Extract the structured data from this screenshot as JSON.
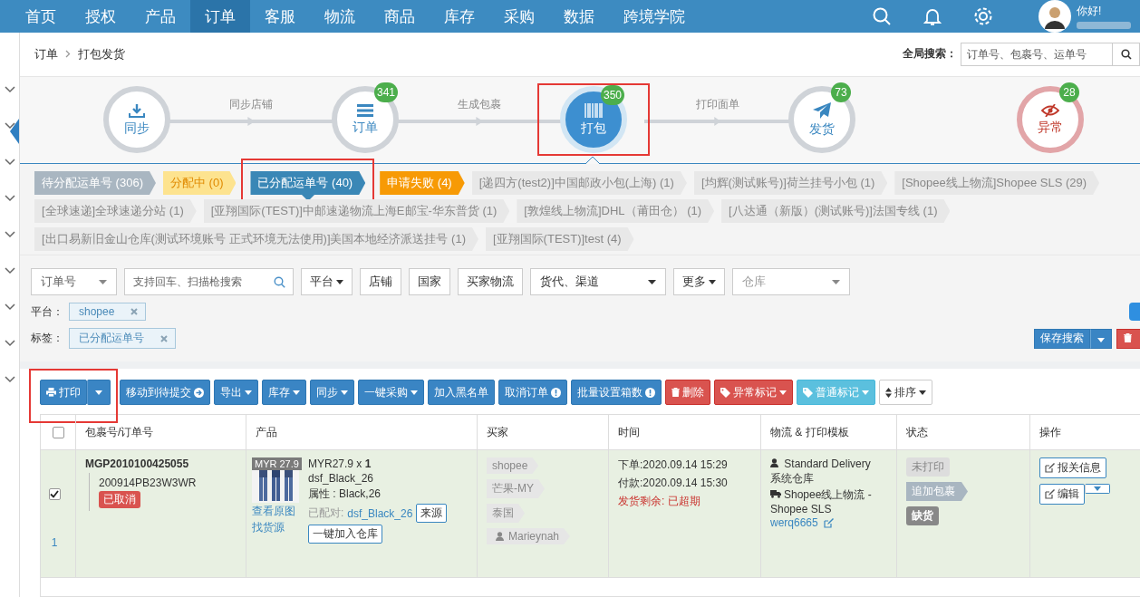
{
  "nav": {
    "items": [
      {
        "label": "首页",
        "selected": false
      },
      {
        "label": "授权",
        "selected": false
      },
      {
        "label": "产品",
        "selected": false
      },
      {
        "label": "订单",
        "selected": true
      },
      {
        "label": "客服",
        "selected": false
      },
      {
        "label": "物流",
        "selected": false
      },
      {
        "label": "商品",
        "selected": false
      },
      {
        "label": "库存",
        "selected": false
      },
      {
        "label": "采购",
        "selected": false
      },
      {
        "label": "数据",
        "selected": false
      },
      {
        "label": "跨境学院",
        "selected": false
      }
    ],
    "greeting": "你好!"
  },
  "breadcrumb": [
    "订单",
    "打包发货"
  ],
  "global_search": {
    "label": "全局搜索：",
    "placeholder": "订单号、包裹号、运单号"
  },
  "steps": [
    {
      "label": "同步",
      "kind": "normal",
      "selected": false,
      "connector": "同步店铺"
    },
    {
      "label": "订单",
      "kind": "normal",
      "selected": false,
      "badge": "341",
      "connector": "生成包裹"
    },
    {
      "label": "打包",
      "kind": "normal",
      "selected": true,
      "badge": "350",
      "connector": "打印面单",
      "annotated": true
    },
    {
      "label": "发货",
      "kind": "normal",
      "selected": false,
      "badge": "73"
    },
    {
      "label": "异常",
      "kind": "alert",
      "selected": false,
      "badge": "28"
    }
  ],
  "tags": [
    {
      "label": "待分配运单号 (306)",
      "kind": "grey",
      "selected": false
    },
    {
      "label": "分配中 (0)",
      "kind": "yellow",
      "selected": false
    },
    {
      "label": "已分配运单号 (40)",
      "kind": "blue",
      "selected": true,
      "annotated": true
    },
    {
      "label": "申请失败 (4)",
      "kind": "orange",
      "selected": false
    },
    {
      "label": "[递四方(test2)]中国邮政小包(上海) (1)",
      "kind": "light",
      "selected": false
    },
    {
      "label": "[均辉(测试账号)]荷兰挂号小包 (1)",
      "kind": "light",
      "selected": false
    },
    {
      "label": "[Shopee线上物流]Shopee SLS (29)",
      "kind": "light",
      "selected": false
    },
    {
      "label": "[全球速递]全球速递分站 (1)",
      "kind": "light",
      "selected": false
    },
    {
      "label": "[亚翔国际(TEST)]中邮速递物流上海E邮宝-华东普货 (1)",
      "kind": "light",
      "selected": false
    },
    {
      "label": "[敦煌线上物流]DHL（莆田仓） (1)",
      "kind": "light",
      "selected": false
    },
    {
      "label": "[八达通（新版）(测试账号)]法国专线 (1)",
      "kind": "light",
      "selected": false
    },
    {
      "label": "[出口易新旧金山仓库(测试环境账号 正式环境无法使用)]美国本地经济派送挂号 (1)",
      "kind": "light",
      "selected": false
    },
    {
      "label": "[亚翔国际(TEST)]test (4)",
      "kind": "light",
      "selected": false
    }
  ],
  "filters": [
    {
      "kind": "select",
      "label": "订单号"
    },
    {
      "kind": "search",
      "placeholder": "支持回车、扫描枪搜索"
    },
    {
      "kind": "dropdown",
      "label": "平台"
    },
    {
      "kind": "button",
      "label": "店铺"
    },
    {
      "kind": "button",
      "label": "国家"
    },
    {
      "kind": "button",
      "label": "买家物流"
    },
    {
      "kind": "select-wide",
      "label": "货代、渠道"
    },
    {
      "kind": "dropdown",
      "label": "更多"
    },
    {
      "kind": "select-placeholder",
      "label": "仓库"
    }
  ],
  "chips": [
    {
      "label": "平台：",
      "value": "shopee"
    },
    {
      "label": "标签：",
      "value": "已分配运单号"
    }
  ],
  "save_search": "保存搜索",
  "toolbar": [
    {
      "label": "打印",
      "kind": "split",
      "annotated": true
    },
    {
      "label": "移动到待提交",
      "kind": "arrow"
    },
    {
      "label": "导出",
      "kind": "dropdown"
    },
    {
      "label": "库存",
      "kind": "dropdown"
    },
    {
      "label": "同步",
      "kind": "dropdown"
    },
    {
      "label": "一键采购",
      "kind": "dropdown"
    },
    {
      "label": "加入黑名单",
      "kind": "plain"
    },
    {
      "label": "取消订单",
      "kind": "info"
    },
    {
      "label": "批量设置箱数",
      "kind": "info"
    },
    {
      "label": "删除",
      "kind": "delete"
    },
    {
      "label": "异常标记",
      "kind": "danger-tag"
    },
    {
      "label": "普通标记",
      "kind": "info-tag"
    },
    {
      "label": "排序",
      "kind": "sort"
    }
  ],
  "table": {
    "select_all": false,
    "columns": [
      "包裹号/订单号",
      "产品",
      "买家",
      "时间",
      "物流 & 打印模板",
      "状态",
      "操作"
    ],
    "rows": [
      {
        "checked": true,
        "index": "1",
        "package_no": "MGP2010100425055",
        "order_no": "200914PB23W3WR",
        "order_status": "已取消",
        "price_tag": "MYR 27.9",
        "qty_line": "MYR27.9 x **1**",
        "sku": "dsf_Black_26",
        "attrs": "属性 : Black,26",
        "links": [
          "查看原图",
          "找货源"
        ],
        "paired_label": "已配对:",
        "paired_sku": "dsf_Black_26",
        "source_button": "来源",
        "warehouse_button": "一键加入仓库",
        "buyer_tags": [
          {
            "label": "shopee",
            "kind": "plain"
          },
          {
            "label": "芒果-MY",
            "kind": "plain"
          },
          {
            "label": "泰国",
            "kind": "plain"
          },
          {
            "label": "Marieynah",
            "kind": "user"
          }
        ],
        "times": [
          {
            "text": "下单:2020.09.14 15:29",
            "kind": "normal"
          },
          {
            "text": "付款:2020.09.14 15:30",
            "kind": "normal"
          },
          {
            "text": "发货剩余: 已超期",
            "kind": "alert"
          }
        ],
        "logistics": {
          "service": "Standard Delivery",
          "warehouse": "系统仓库",
          "carrier": "Shopee线上物流 - Shopee SLS",
          "tracking": "werq6665"
        },
        "statuses": [
          {
            "label": "未打印",
            "kind": "light"
          },
          {
            "label": "追加包裹",
            "kind": "arrow"
          },
          {
            "label": "缺货",
            "kind": "dark"
          }
        ],
        "actions": [
          "报关信息",
          "编辑"
        ]
      }
    ]
  }
}
